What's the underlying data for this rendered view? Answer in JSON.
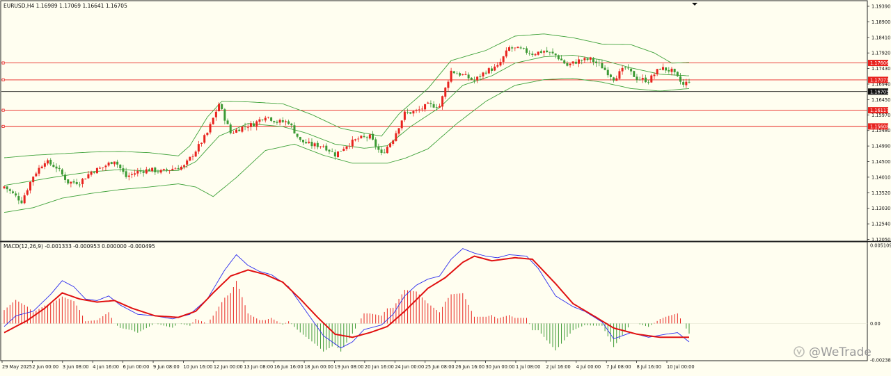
{
  "symbol_info": "EURUSD,H4  1.16989 1.17069 1.16641 1.16705",
  "macd_info": "MACD(12,26,9) -0.001333 -0.000953 0.000000 -0.000495",
  "watermark": "@WeTrade",
  "colors": {
    "background": "#fffef0",
    "bull": "#e8231e",
    "bear": "#3d9a35",
    "bollinger": "#3fa23a",
    "level_line": "#e8231e",
    "current_line": "#111111",
    "macd_line": "#2a2aee",
    "signal_line": "#e01010",
    "hist_pos": "#e8231e",
    "hist_neg": "#3d9a35"
  },
  "icons": {
    "dropdown": "triangle-down-icon",
    "watermark_logo": "wetrade-logo-icon"
  },
  "chart_data": [
    {
      "type": "candlestick",
      "name_text": "EURUSD,H4",
      "ylim": [
        1.1205,
        1.1939
      ],
      "y_ticks": [
        "1.19390",
        "1.18900",
        "1.18410",
        "1.17920",
        "1.17430",
        "1.16940",
        "1.16450",
        "1.15970",
        "1.15480",
        "1.14990",
        "1.14500",
        "1.14010",
        "1.13520",
        "1.13030",
        "1.12540",
        "1.12050"
      ],
      "x_ticks": [
        "29 May 2025",
        "2 Jun 00:00",
        "3 Jun 08:00",
        "4 Jun 16:00",
        "6 Jun 00:00",
        "9 Jun 08:00",
        "10 Jun 16:00",
        "12 Jun 00:00",
        "13 Jun 08:00",
        "16 Jun 16:00",
        "18 Jun 00:00",
        "19 Jun 08:00",
        "20 Jun 16:00",
        "24 Jun 00:00",
        "25 Jun 08:00",
        "26 Jun 16:00",
        "30 Jun 00:00",
        "1 Jul 08:00",
        "2 Jul 16:00",
        "4 Jul 00:00",
        "7 Jul 08:00",
        "8 Jul 16:00",
        "10 Jul 00:00"
      ],
      "price_levels": [
        {
          "value": 1.17606,
          "label": "1.17606"
        },
        {
          "value": 1.17073,
          "label": "1.17073"
        },
        {
          "value": 1.16117,
          "label": "1.16117"
        },
        {
          "value": 1.15608,
          "label": "1.15608"
        }
      ],
      "current_price": {
        "value": 1.16705,
        "label": "1.16705"
      },
      "close_anchors": [
        [
          0,
          1.1372
        ],
        [
          6,
          1.1325
        ],
        [
          10,
          1.1405
        ],
        [
          14,
          1.1452
        ],
        [
          18,
          1.1432
        ],
        [
          22,
          1.1385
        ],
        [
          26,
          1.1385
        ],
        [
          30,
          1.1418
        ],
        [
          34,
          1.1432
        ],
        [
          38,
          1.1455
        ],
        [
          42,
          1.1402
        ],
        [
          46,
          1.1418
        ],
        [
          50,
          1.1425
        ],
        [
          54,
          1.1418
        ],
        [
          58,
          1.1428
        ],
        [
          62,
          1.1435
        ],
        [
          66,
          1.1485
        ],
        [
          70,
          1.154
        ],
        [
          74,
          1.1632
        ],
        [
          78,
          1.154
        ],
        [
          82,
          1.1558
        ],
        [
          86,
          1.1568
        ],
        [
          90,
          1.1595
        ],
        [
          94,
          1.1575
        ],
        [
          98,
          1.1575
        ],
        [
          102,
          1.1515
        ],
        [
          106,
          1.1502
        ],
        [
          110,
          1.15
        ],
        [
          114,
          1.1472
        ],
        [
          118,
          1.1502
        ],
        [
          122,
          1.1522
        ],
        [
          126,
          1.1528
        ],
        [
          130,
          1.1472
        ],
        [
          134,
          1.1522
        ],
        [
          138,
          1.1602
        ],
        [
          142,
          1.1608
        ],
        [
          146,
          1.1628
        ],
        [
          150,
          1.1625
        ],
        [
          154,
          1.1735
        ],
        [
          158,
          1.1722
        ],
        [
          162,
          1.1705
        ],
        [
          166,
          1.1735
        ],
        [
          170,
          1.1748
        ],
        [
          174,
          1.1808
        ],
        [
          178,
          1.1802
        ],
        [
          182,
          1.179
        ],
        [
          186,
          1.1798
        ],
        [
          190,
          1.1785
        ],
        [
          194,
          1.1752
        ],
        [
          198,
          1.1768
        ],
        [
          202,
          1.1772
        ],
        [
          206,
          1.1748
        ],
        [
          210,
          1.1712
        ],
        [
          214,
          1.1745
        ],
        [
          218,
          1.1712
        ],
        [
          222,
          1.1705
        ],
        [
          226,
          1.1745
        ],
        [
          230,
          1.1735
        ],
        [
          234,
          1.169
        ],
        [
          236,
          1.1705
        ]
      ],
      "bollinger": {
        "upper": [
          [
            0,
            1.1462
          ],
          [
            10,
            1.147
          ],
          [
            20,
            1.1475
          ],
          [
            30,
            1.148
          ],
          [
            40,
            1.1482
          ],
          [
            50,
            1.1478
          ],
          [
            60,
            1.1468
          ],
          [
            64,
            1.15
          ],
          [
            70,
            1.159
          ],
          [
            75,
            1.164
          ],
          [
            84,
            1.1638
          ],
          [
            96,
            1.1632
          ],
          [
            106,
            1.1598
          ],
          [
            116,
            1.1555
          ],
          [
            124,
            1.154
          ],
          [
            130,
            1.153
          ],
          [
            136,
            1.16
          ],
          [
            146,
            1.168
          ],
          [
            154,
            1.1768
          ],
          [
            166,
            1.18
          ],
          [
            176,
            1.1845
          ],
          [
            186,
            1.1852
          ],
          [
            196,
            1.184
          ],
          [
            206,
            1.182
          ],
          [
            216,
            1.1818
          ],
          [
            224,
            1.1792
          ],
          [
            230,
            1.176
          ],
          [
            236,
            1.1762
          ]
        ],
        "middle": [
          [
            0,
            1.1375
          ],
          [
            10,
            1.139
          ],
          [
            20,
            1.1405
          ],
          [
            30,
            1.1418
          ],
          [
            40,
            1.1425
          ],
          [
            50,
            1.142
          ],
          [
            60,
            1.1422
          ],
          [
            66,
            1.145
          ],
          [
            74,
            1.153
          ],
          [
            84,
            1.157
          ],
          [
            96,
            1.156
          ],
          [
            104,
            1.154
          ],
          [
            114,
            1.1505
          ],
          [
            124,
            1.1492
          ],
          [
            132,
            1.15
          ],
          [
            140,
            1.156
          ],
          [
            150,
            1.162
          ],
          [
            158,
            1.169
          ],
          [
            168,
            1.172
          ],
          [
            176,
            1.176
          ],
          [
            186,
            1.178
          ],
          [
            196,
            1.1785
          ],
          [
            206,
            1.177
          ],
          [
            216,
            1.1745
          ],
          [
            226,
            1.1725
          ],
          [
            236,
            1.172
          ]
        ],
        "lower": [
          [
            0,
            1.129
          ],
          [
            10,
            1.1305
          ],
          [
            20,
            1.1335
          ],
          [
            30,
            1.135
          ],
          [
            40,
            1.1362
          ],
          [
            50,
            1.137
          ],
          [
            60,
            1.138
          ],
          [
            66,
            1.137
          ],
          [
            72,
            1.134
          ],
          [
            80,
            1.14
          ],
          [
            90,
            1.1485
          ],
          [
            100,
            1.1505
          ],
          [
            110,
            1.147
          ],
          [
            120,
            1.1445
          ],
          [
            132,
            1.1445
          ],
          [
            138,
            1.146
          ],
          [
            146,
            1.149
          ],
          [
            156,
            1.157
          ],
          [
            166,
            1.164
          ],
          [
            176,
            1.169
          ],
          [
            186,
            1.1708
          ],
          [
            196,
            1.1712
          ],
          [
            206,
            1.17
          ],
          [
            216,
            1.168
          ],
          [
            226,
            1.1672
          ],
          [
            236,
            1.168
          ]
        ]
      }
    },
    {
      "type": "macd",
      "ylim": [
        -0.002388,
        0.005109
      ],
      "y_ticks": [
        {
          "value": 0.005109,
          "label": "0.005109"
        },
        {
          "value": 0.0,
          "label": "0.00"
        },
        {
          "value": -0.002388,
          "label": "-0.002388"
        }
      ],
      "macd": [
        [
          0,
          -0.0002
        ],
        [
          4,
          0.0005
        ],
        [
          10,
          0.0008
        ],
        [
          16,
          0.0019
        ],
        [
          20,
          0.0028
        ],
        [
          24,
          0.0024
        ],
        [
          28,
          0.0016
        ],
        [
          32,
          0.0015
        ],
        [
          36,
          0.0018
        ],
        [
          40,
          0.0012
        ],
        [
          46,
          0.0006
        ],
        [
          52,
          0.0005
        ],
        [
          58,
          0.0003
        ],
        [
          64,
          0.0006
        ],
        [
          70,
          0.0016
        ],
        [
          76,
          0.0035
        ],
        [
          80,
          0.0045
        ],
        [
          84,
          0.0038
        ],
        [
          88,
          0.0034
        ],
        [
          92,
          0.0032
        ],
        [
          98,
          0.0024
        ],
        [
          104,
          0.0008
        ],
        [
          110,
          -0.0008
        ],
        [
          116,
          -0.0016
        ],
        [
          120,
          -0.0012
        ],
        [
          124,
          -0.0004
        ],
        [
          130,
          -0.0001
        ],
        [
          134,
          0.0006
        ],
        [
          138,
          0.0018
        ],
        [
          142,
          0.0025
        ],
        [
          146,
          0.0029
        ],
        [
          150,
          0.0031
        ],
        [
          154,
          0.0042
        ],
        [
          158,
          0.0049
        ],
        [
          162,
          0.0046
        ],
        [
          166,
          0.0044
        ],
        [
          170,
          0.0043
        ],
        [
          174,
          0.0045
        ],
        [
          180,
          0.0044
        ],
        [
          184,
          0.0036
        ],
        [
          190,
          0.0018
        ],
        [
          196,
          0.0011
        ],
        [
          200,
          0.0008
        ],
        [
          206,
          0.0001
        ],
        [
          210,
          -0.001
        ],
        [
          216,
          -0.0006
        ],
        [
          222,
          -0.0009
        ],
        [
          228,
          -0.0007
        ],
        [
          232,
          -0.0006
        ],
        [
          236,
          -0.0012
        ]
      ],
      "signal": [
        [
          0,
          -0.0006
        ],
        [
          8,
          0.0002
        ],
        [
          14,
          0.001
        ],
        [
          20,
          0.002
        ],
        [
          26,
          0.0016
        ],
        [
          32,
          0.0014
        ],
        [
          38,
          0.0015
        ],
        [
          44,
          0.001
        ],
        [
          52,
          0.0005
        ],
        [
          60,
          0.0004
        ],
        [
          66,
          0.0008
        ],
        [
          72,
          0.002
        ],
        [
          78,
          0.0031
        ],
        [
          84,
          0.0035
        ],
        [
          90,
          0.0032
        ],
        [
          96,
          0.0027
        ],
        [
          102,
          0.0016
        ],
        [
          108,
          0.0004
        ],
        [
          114,
          -0.0007
        ],
        [
          120,
          -0.0009
        ],
        [
          126,
          -0.0006
        ],
        [
          132,
          -0.0002
        ],
        [
          138,
          0.0008
        ],
        [
          146,
          0.0023
        ],
        [
          152,
          0.003
        ],
        [
          158,
          0.004
        ],
        [
          162,
          0.0044
        ],
        [
          168,
          0.0041
        ],
        [
          176,
          0.0043
        ],
        [
          182,
          0.0042
        ],
        [
          190,
          0.0026
        ],
        [
          196,
          0.0013
        ],
        [
          204,
          0.0004
        ],
        [
          210,
          -0.0003
        ],
        [
          218,
          -0.0007
        ],
        [
          226,
          -0.0009
        ],
        [
          236,
          -0.0009
        ]
      ]
    }
  ]
}
